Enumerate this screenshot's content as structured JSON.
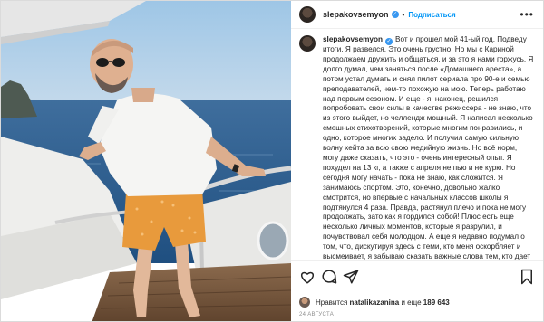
{
  "header": {
    "username": "slepakovsemyon",
    "separator": "•",
    "follow_label": "Подписаться",
    "more_label": "•••"
  },
  "caption": {
    "username": "slepakovsemyon",
    "text": "Вот и прошел мой 41-ый год. Подведу итоги. Я развелся. Это очень грустно. Но мы с Кариной продолжаем дружить и общаться, и за это я нами горжусь. Я долго думал, чем заняться после «Домашнего ареста», а потом устал думать и снял пилот сериала про 90-е и семью преподавателей, чем-то похожую на мою. Теперь работаю над первым сезоном. И еще - я, наконец, решился попробовать свои силы в качестве режиссера - не знаю, что из этого выйдет, но челлендж мощный. Я написал несколько смешных стихотворений, которые многим понравились, и одно, которое многих задело. И получил самую сильную волну хейта за всю свою медийную жизнь. Но всё норм, могу даже сказать, что это - очень интересный опыт. Я похудел на 13 кг, а также с апреля не пью и не курю. Но сегодня могу начать - пока не знаю, как сложится. Я занимаюсь спортом. Это, конечно, довольно жалко смотрится, но впервые с начальных классов школы я подтянулся 4 раза. Правда, растянул плечо и пока не могу продолжать, зато как я гордился собой! Плюс есть еще несколько личных моментов, которые я разрулил, и почувствовал себя молодцом. А еще я недавно подумал о том, что, дискутируя здесь с теми, кто меня оскорбляет и высмеивает, я забываю сказать важные слова тем, кто дает мне поддержку, любовь и силы двигаться дальше. И мне кажется, что сегодня - идеальный день, чтобы это сделать. Дорогие мои подписчики! Вы для меня очень важны. Я радуюсь, когда Вы ставите свои смайлики и"
  },
  "likes": {
    "prefix": "Нравится",
    "user": "natalikazanina",
    "middle": "и еще",
    "count": "189 643"
  },
  "date": "24 АВГУСТА",
  "icons": {
    "like": "heart-icon",
    "comment": "comment-icon",
    "share": "share-icon",
    "save": "bookmark-icon",
    "verified": "verified-badge-icon"
  },
  "colors": {
    "accent": "#0095f6",
    "verified": "#3897f0",
    "muted": "#8e8e8e"
  }
}
